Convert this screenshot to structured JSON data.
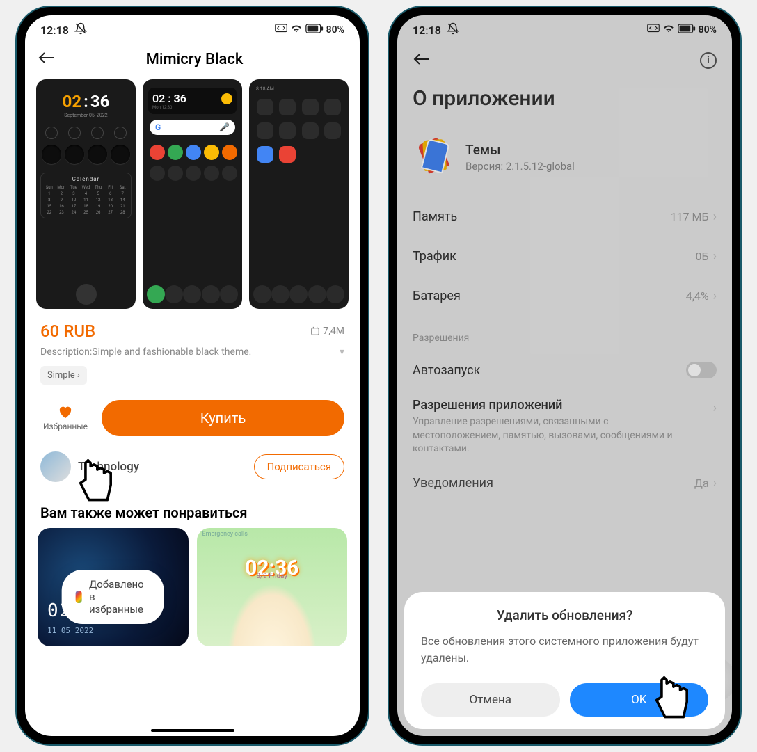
{
  "status": {
    "time": "12:18",
    "battery": "80%"
  },
  "phone1": {
    "title": "Mimicry Black",
    "preview_clock": {
      "h": "02",
      "m": "36",
      "date": "September 05, 2022"
    },
    "preview_calendar_title": "Calendar",
    "price": "60 RUB",
    "size": "7,4M",
    "description": "Description:Simple and fashionable black theme.",
    "tag": "Simple",
    "favorite_label": "Избранные",
    "buy_label": "Купить",
    "author": "Technology",
    "subscribe_label": "Подписаться",
    "similar_title": "Вам также может понравиться",
    "sim1_clock": "02:36",
    "sim1_date": "11 05 2022",
    "sim2_clock": "02:36",
    "sim2_sub": "8/9 Friday",
    "toast": "Добавлено в избранные"
  },
  "phone2": {
    "header": "О приложении",
    "app_name": "Темы",
    "app_version_label": "Версия: 2.1.5.12-global",
    "row_memory": "Память",
    "val_memory": "117 МБ",
    "row_traffic": "Трафик",
    "val_traffic": "0Б",
    "row_battery": "Батарея",
    "val_battery": "4,4%",
    "section_permissions": "Разрешения",
    "row_autostart": "Автозапуск",
    "perm_title": "Разрешения приложений",
    "perm_desc": "Управление разрешениями, связанными с местоположением, памятью, вызовами, сообщениями и контактами.",
    "row_notifications": "Уведомления",
    "val_notifications": "Да",
    "dialog": {
      "title": "Удалить обновления?",
      "body": "Все обновления этого системного приложения будут удалены.",
      "cancel": "Отмена",
      "ok": "OK"
    }
  }
}
